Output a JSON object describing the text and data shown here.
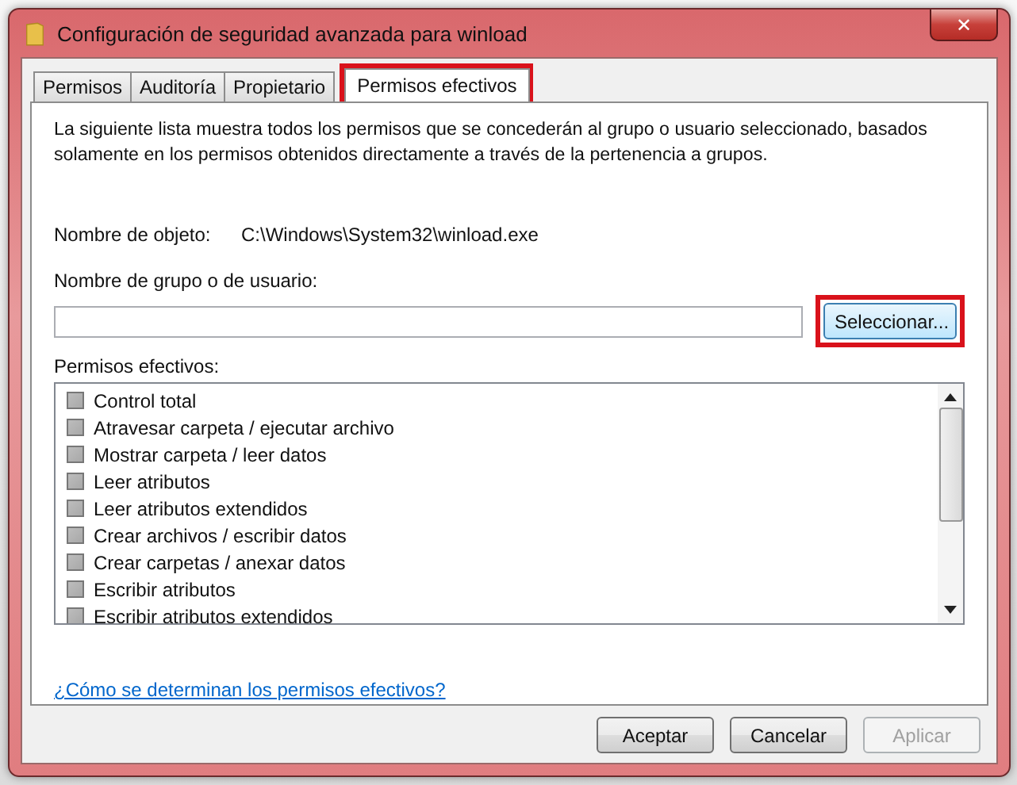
{
  "window": {
    "title": "Configuración de seguridad avanzada para winload",
    "close": "✕"
  },
  "tabs": [
    {
      "label": "Permisos",
      "selected": false,
      "highlighted": false
    },
    {
      "label": "Auditoría",
      "selected": false,
      "highlighted": false
    },
    {
      "label": "Propietario",
      "selected": false,
      "highlighted": false
    },
    {
      "label": "Permisos efectivos",
      "selected": true,
      "highlighted": true
    }
  ],
  "description": "La siguiente lista muestra todos los permisos que se concederán al grupo o usuario seleccionado, basados solamente en los permisos obtenidos directamente a través de la pertenencia a grupos.",
  "object": {
    "label": "Nombre de objeto:",
    "value": "C:\\Windows\\System32\\winload.exe"
  },
  "user_field": {
    "label": "Nombre de grupo o de usuario:"
  },
  "select_button": {
    "label": "Seleccionar...",
    "highlighted": true
  },
  "permissions_label": "Permisos efectivos:",
  "permissions": [
    {
      "label": "Control total",
      "checked": false
    },
    {
      "label": "Atravesar carpeta / ejecutar archivo",
      "checked": false
    },
    {
      "label": "Mostrar carpeta / leer datos",
      "checked": false
    },
    {
      "label": "Leer atributos",
      "checked": false
    },
    {
      "label": "Leer atributos extendidos",
      "checked": false
    },
    {
      "label": "Crear archivos / escribir datos",
      "checked": false
    },
    {
      "label": "Crear carpetas / anexar datos",
      "checked": false
    },
    {
      "label": "Escribir atributos",
      "checked": false
    },
    {
      "label": "Escribir atributos extendidos",
      "checked": false
    }
  ],
  "help_link": "¿Cómo se determinan los permisos efectivos?",
  "buttons": [
    {
      "label": "Aceptar",
      "disabled": false
    },
    {
      "label": "Cancelar",
      "disabled": false
    },
    {
      "label": "Aplicar",
      "disabled": true
    }
  ]
}
